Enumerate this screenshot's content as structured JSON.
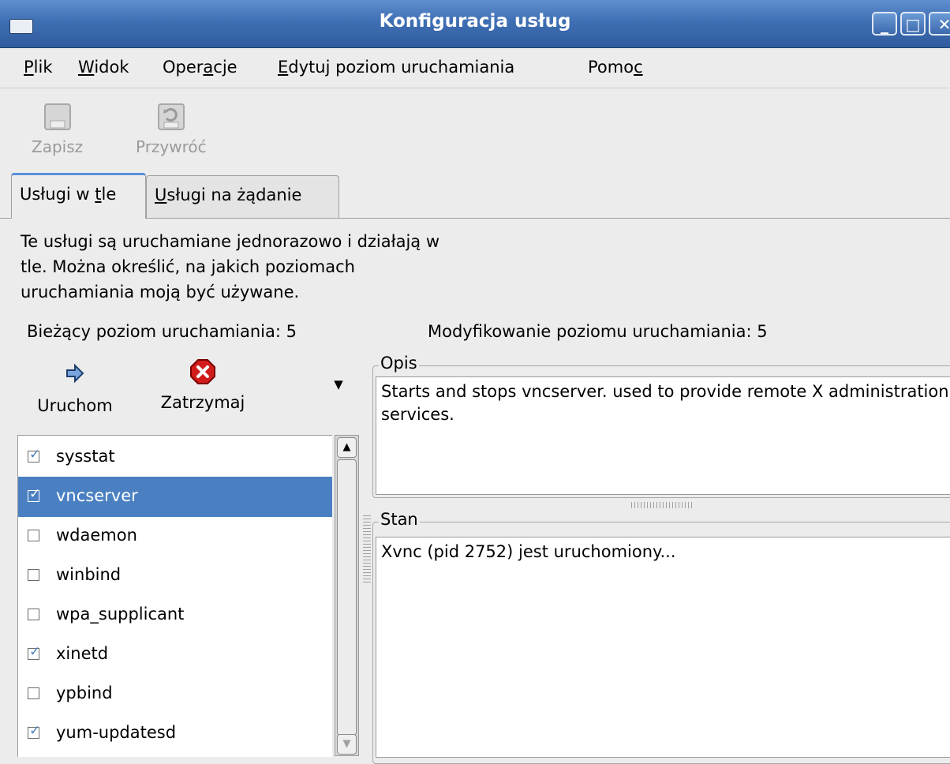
{
  "window": {
    "title": "Konfiguracja usług"
  },
  "menu": [
    {
      "pre": "",
      "u": "P",
      "post": "lik"
    },
    {
      "pre": "",
      "u": "W",
      "post": "idok"
    },
    {
      "pre": "Oper",
      "u": "a",
      "post": "cje"
    },
    {
      "pre": "",
      "u": "E",
      "post": "dytuj poziom uruchamiania"
    },
    {
      "pre": "Pomo",
      "u": "c",
      "post": ""
    }
  ],
  "toolbar": {
    "save_label": "Zapisz",
    "revert_label": "Przywróć"
  },
  "tabs": [
    {
      "pre": "Usługi w ",
      "u": "t",
      "post": "le"
    },
    {
      "pre": "",
      "u": "U",
      "post": "sługi na żądanie"
    }
  ],
  "description_lines": [
    "Te usługi są uruchamiane jednorazowo i działają w",
    "tle. Można określić, na jakich poziomach",
    "uruchamiania moją być używane."
  ],
  "current_runlevel": "Bieżący poziom uruchamiania: 5",
  "edit_runlevel": "Modyfikowanie poziomu uruchamiania: 5",
  "actions": {
    "start_label": "Uruchom",
    "stop_label": "Zatrzymaj"
  },
  "services": [
    {
      "name": "sysstat",
      "checked": true,
      "selected": false
    },
    {
      "name": "vncserver",
      "checked": true,
      "selected": true
    },
    {
      "name": "wdaemon",
      "checked": false,
      "selected": false
    },
    {
      "name": "winbind",
      "checked": false,
      "selected": false
    },
    {
      "name": "wpa_supplicant",
      "checked": false,
      "selected": false
    },
    {
      "name": "xinetd",
      "checked": true,
      "selected": false
    },
    {
      "name": "ypbind",
      "checked": false,
      "selected": false
    },
    {
      "name": "yum-updatesd",
      "checked": true,
      "selected": false
    }
  ],
  "opis": {
    "label": "Opis",
    "text": "Starts and stops vncserver. used to provide remote X administration services."
  },
  "stan": {
    "label": "Stan",
    "text": "Xvnc (pid 2752) jest uruchomiony..."
  },
  "colors": {
    "titlebar": "#3f6fb3",
    "selection": "#4a80c2",
    "tab_accent": "#5a8fd8"
  }
}
